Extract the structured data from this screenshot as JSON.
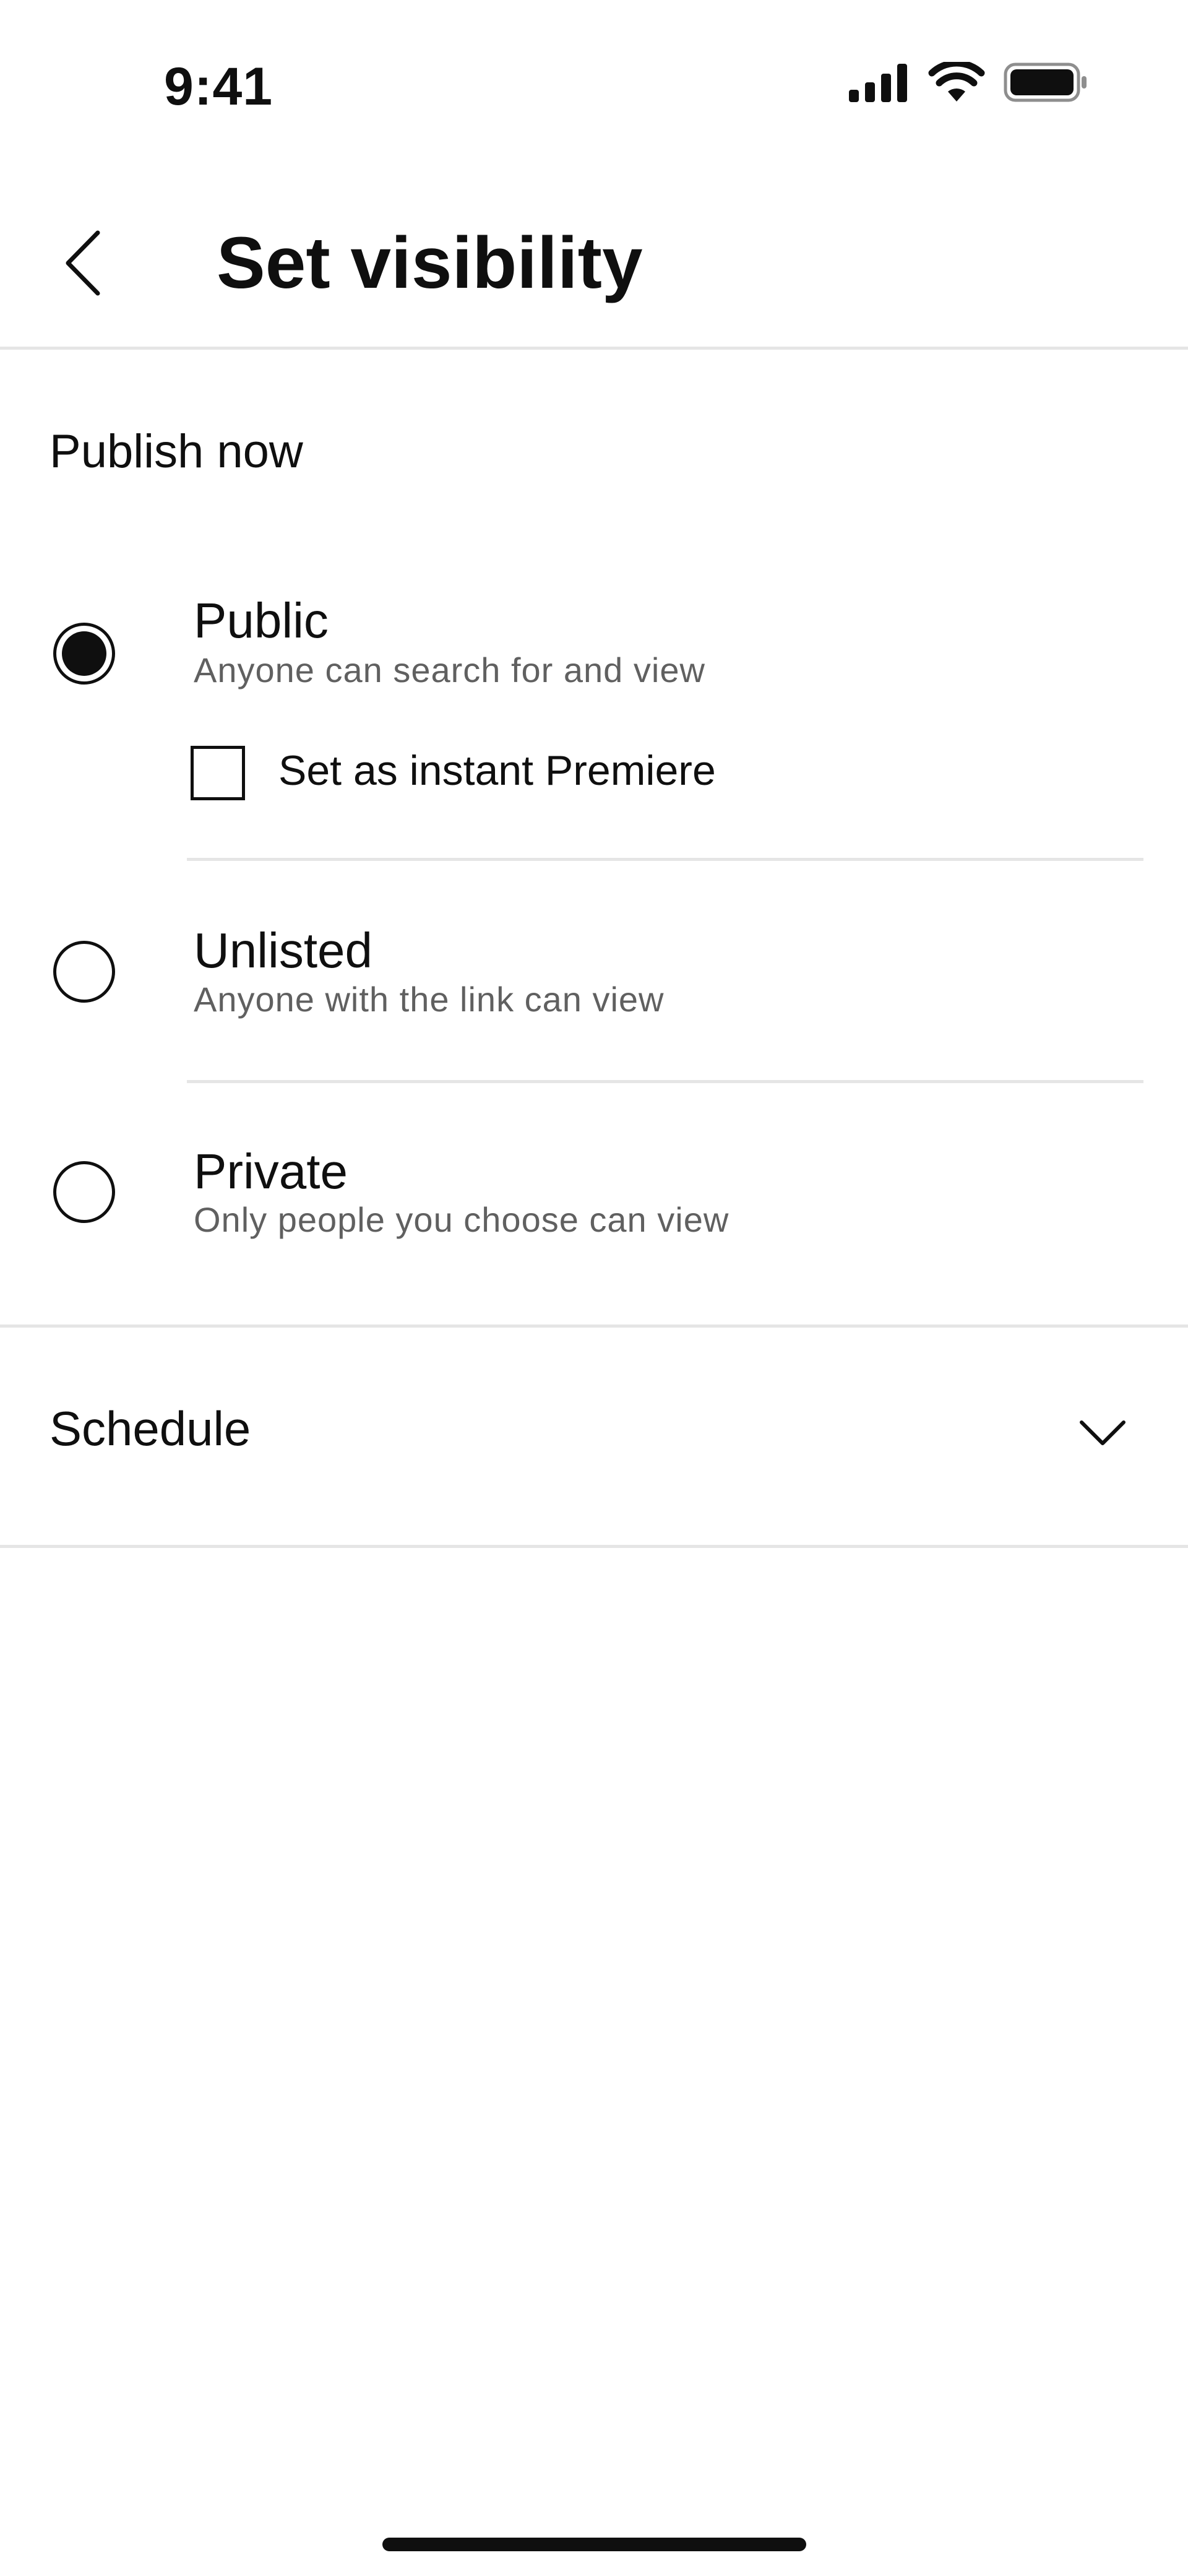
{
  "status_bar": {
    "time": "9:41"
  },
  "header": {
    "title": "Set visibility"
  },
  "publish_now": {
    "label": "Publish now",
    "options": [
      {
        "title": "Public",
        "description": "Anyone can search for and view",
        "selected": true
      },
      {
        "title": "Unlisted",
        "description": "Anyone with the link can view",
        "selected": false
      },
      {
        "title": "Private",
        "description": "Only people you choose can view",
        "selected": false
      }
    ],
    "premiere_checkbox": {
      "label": "Set as instant Premiere",
      "checked": false
    }
  },
  "schedule": {
    "label": "Schedule"
  },
  "icons": {
    "back": "back-chevron-icon",
    "expand": "chevron-down-icon",
    "signal": "cellular-signal-icon",
    "wifi": "wifi-icon",
    "battery": "battery-icon"
  }
}
